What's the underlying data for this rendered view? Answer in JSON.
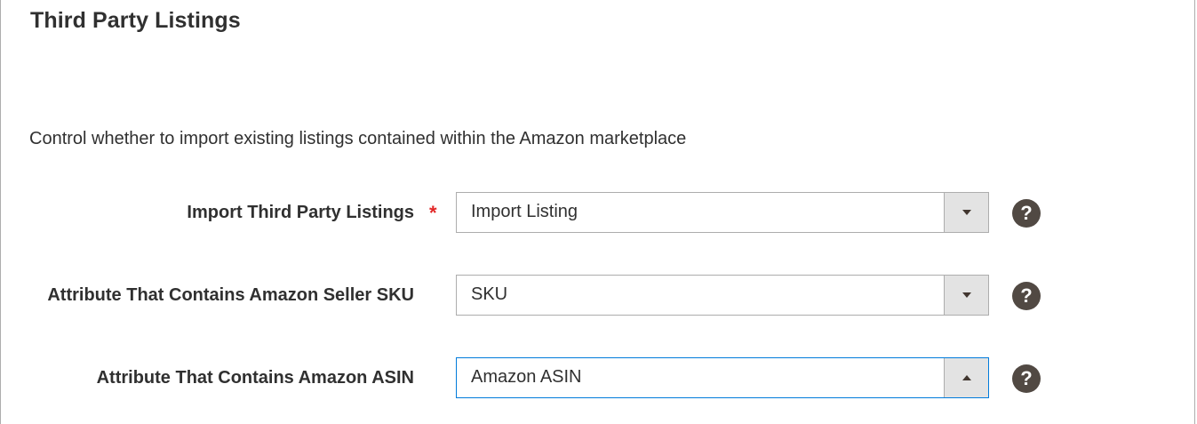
{
  "section": {
    "title": "Third Party Listings",
    "description": "Control whether to import existing listings contained within the Amazon marketplace"
  },
  "fields": [
    {
      "label": "Import Third Party Listings",
      "required": true,
      "required_marker": "*",
      "value": "Import Listing",
      "arrow": "chevron-down-icon",
      "help": "?"
    },
    {
      "label": "Attribute That Contains Amazon Seller SKU",
      "required": false,
      "value": "SKU",
      "arrow": "chevron-down-icon",
      "help": "?"
    },
    {
      "label": "Attribute That Contains Amazon ASIN",
      "required": false,
      "value": "Amazon ASIN",
      "arrow": "chevron-up-icon",
      "state": "open",
      "help": "?"
    }
  ],
  "colors": {
    "required": "#e22626",
    "focus_border": "#007bdb",
    "help_icon_bg": "#514943",
    "arrow_box_bg": "#e3e3e3"
  }
}
